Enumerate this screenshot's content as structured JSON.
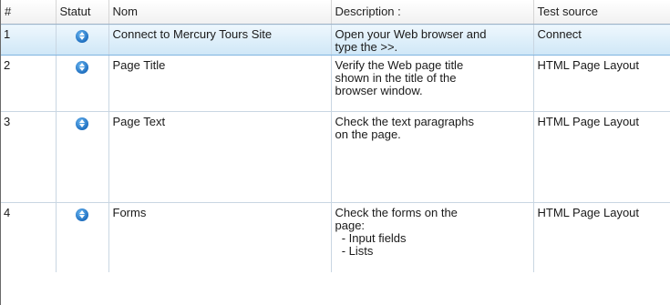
{
  "table": {
    "headers": {
      "num": "#",
      "status": "Statut",
      "name": "Nom",
      "description": "Description :",
      "source": "Test source"
    },
    "rows": [
      {
        "num": "1",
        "status_icon": "pending-status-icon",
        "name": "Connect to Mercury Tours Site",
        "description": [
          "Open your Web browser and",
          "type the >>."
        ],
        "source": "Connect",
        "selected": true
      },
      {
        "num": "2",
        "status_icon": "pending-status-icon",
        "name": "Page Title",
        "description": [
          "Verify the Web page title",
          "shown in the title of the",
          "browser window."
        ],
        "source": "HTML Page Layout",
        "selected": false
      },
      {
        "num": "3",
        "status_icon": "pending-status-icon",
        "name": "Page Text",
        "description": [
          "Check the text paragraphs",
          "on the page."
        ],
        "source": "HTML Page Layout",
        "selected": false
      },
      {
        "num": "4",
        "status_icon": "pending-status-icon",
        "name": "Forms",
        "description": [
          "Check the forms on the",
          "page:",
          "  - Input fields",
          "  - Lists"
        ],
        "source": "HTML Page Layout",
        "selected": false
      }
    ]
  },
  "colors": {
    "selected_row": "#cfe7f7",
    "status_icon": "#1f6fc0",
    "grid_line": "#c9d6e2"
  }
}
